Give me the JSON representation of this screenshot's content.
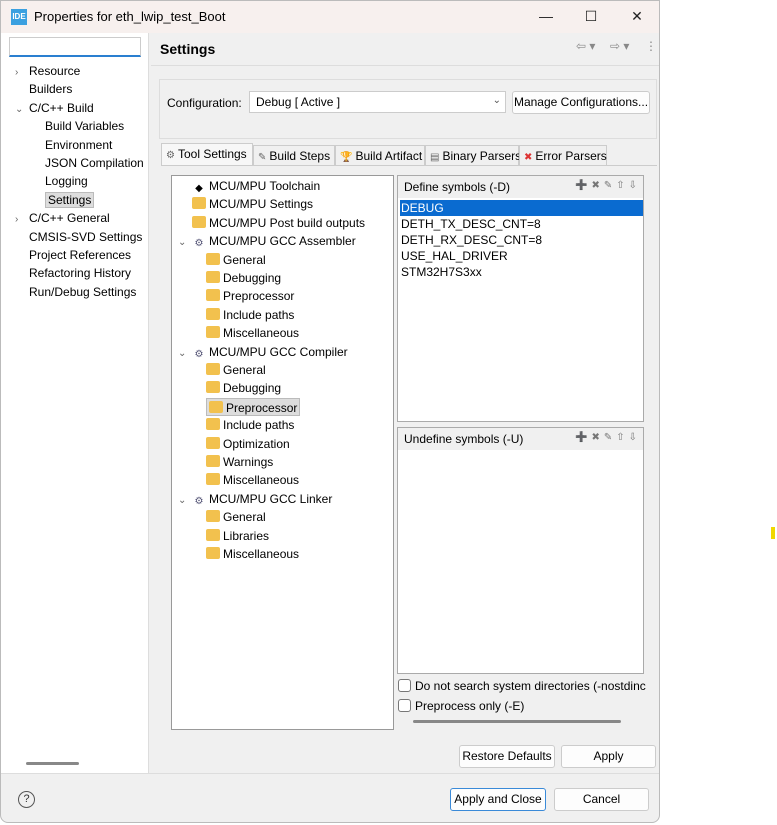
{
  "window": {
    "icon_text": "IDE",
    "title": "Properties for eth_lwip_test_Boot",
    "minimize": "—",
    "maximize": "☐",
    "close": "✕"
  },
  "left": {
    "search_value": "",
    "items": [
      {
        "label": "Resource",
        "chev": "›"
      },
      {
        "label": "Builders",
        "chev": ""
      },
      {
        "label": "C/C++ Build",
        "chev": "⌄"
      },
      {
        "label": "Build Variables"
      },
      {
        "label": "Environment"
      },
      {
        "label": "JSON Compilation"
      },
      {
        "label": "Logging"
      },
      {
        "label": "Settings"
      },
      {
        "label": "C/C++ General",
        "chev": "›"
      },
      {
        "label": "CMSIS-SVD Settings",
        "chev": ""
      },
      {
        "label": "Project References",
        "chev": ""
      },
      {
        "label": "Refactoring History",
        "chev": ""
      },
      {
        "label": "Run/Debug Settings",
        "chev": ""
      }
    ]
  },
  "header": {
    "title": "Settings",
    "back": "⇦ ▾",
    "forward": "⇨ ▾",
    "menu": "⋮"
  },
  "config": {
    "label": "Configuration:",
    "value": "Debug  [ Active ]",
    "manage": "Manage Configurations..."
  },
  "tabs": [
    {
      "label": "Tool Settings",
      "icon": "⚙"
    },
    {
      "label": "Build Steps",
      "icon": "✎"
    },
    {
      "label": "Build Artifact",
      "icon": "🏆"
    },
    {
      "label": "Binary Parsers",
      "icon": "▤"
    },
    {
      "label": "Error Parsers",
      "icon": "✖"
    }
  ],
  "tree": [
    {
      "label": "MCU/MPU Toolchain",
      "chev": ""
    },
    {
      "label": "MCU/MPU Settings",
      "chev": ""
    },
    {
      "label": "MCU/MPU Post build outputs",
      "chev": ""
    },
    {
      "label": "MCU/MPU GCC Assembler",
      "chev": "⌄"
    },
    {
      "label": "General"
    },
    {
      "label": "Debugging"
    },
    {
      "label": "Preprocessor"
    },
    {
      "label": "Include paths"
    },
    {
      "label": "Miscellaneous"
    },
    {
      "label": "MCU/MPU GCC Compiler",
      "chev": "⌄"
    },
    {
      "label": "General"
    },
    {
      "label": "Debugging"
    },
    {
      "label": "Preprocessor"
    },
    {
      "label": "Include paths"
    },
    {
      "label": "Optimization"
    },
    {
      "label": "Warnings"
    },
    {
      "label": "Miscellaneous"
    },
    {
      "label": "MCU/MPU GCC Linker",
      "chev": "⌄"
    },
    {
      "label": "General"
    },
    {
      "label": "Libraries"
    },
    {
      "label": "Miscellaneous"
    }
  ],
  "define": {
    "title": "Define symbols (-D)",
    "items": [
      "DEBUG",
      "DETH_TX_DESC_CNT=8",
      "DETH_RX_DESC_CNT=8",
      "USE_HAL_DRIVER",
      "STM32H7S3xx"
    ]
  },
  "undefine": {
    "title": "Undefine symbols (-U)",
    "items": []
  },
  "options": [
    {
      "label": "Do not search system directories (-nostdinc",
      "checked": false
    },
    {
      "label": "Preprocess only (-E)",
      "checked": false
    }
  ],
  "buttons": {
    "restore": "Restore Defaults",
    "apply": "Apply",
    "apply_close": "Apply and Close",
    "cancel": "Cancel",
    "help": "?"
  }
}
